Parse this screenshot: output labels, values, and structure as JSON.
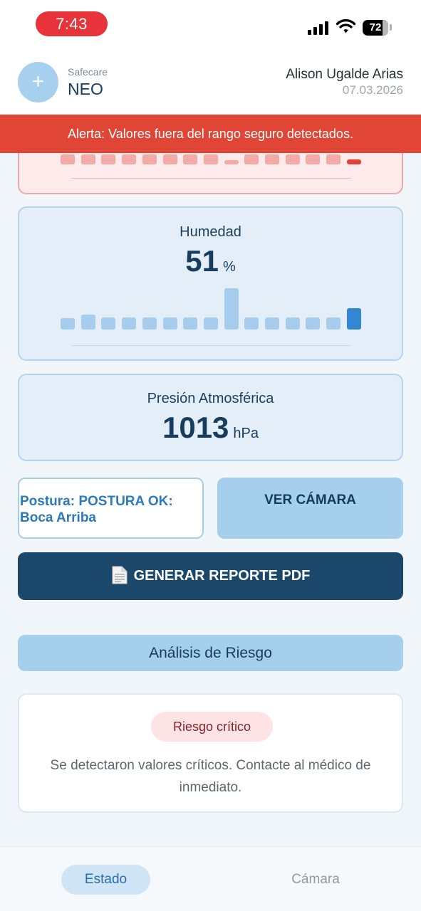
{
  "status_bar": {
    "time": "7:43",
    "battery": "72",
    "icons": [
      "signal-icon",
      "wifi-icon",
      "battery-icon"
    ]
  },
  "header": {
    "logo_symbol": "+",
    "brand_small": "Safecare",
    "brand_name": "NEO",
    "user_name": "Alison Ugalde Arias",
    "date": "07.03.2026"
  },
  "alert": {
    "text": "Alerta: Valores fuera del rango seguro detectados."
  },
  "temperature_card": {
    "bar_values": [
      10,
      10,
      10,
      10,
      10,
      10,
      10,
      10,
      4,
      10,
      10,
      10,
      10,
      10,
      5
    ],
    "highlight_index": 14,
    "colors": {
      "bar": "#f3a9a6",
      "highlight": "#e0423a",
      "background": "#fdeaea",
      "border": "#ecaaa8"
    }
  },
  "humidity_card": {
    "title": "Humedad",
    "value": "51",
    "unit": "%",
    "bar_values": [
      14,
      19,
      15,
      15,
      15,
      15,
      15,
      15,
      52,
      15,
      15,
      15,
      15,
      15,
      27
    ],
    "highlight_index": 14,
    "colors": {
      "bar": "#a6cdee",
      "highlight": "#3387d2",
      "background": "#e3eef9",
      "border": "#b4d3ee"
    }
  },
  "pressure_card": {
    "title": "Presión Atmosférica",
    "value": "1013",
    "unit": "hPa"
  },
  "posture": {
    "line1": "Postura: POSTURA OK:",
    "line2": "Boca Arriba"
  },
  "buttons": {
    "camera": "VER CÁMARA",
    "pdf": "GENERAR REPORTE PDF",
    "pdf_icon": "document-icon"
  },
  "risk": {
    "header": "Análisis de Riesgo",
    "badge": "Riesgo crítico",
    "message": "Se detectaron valores críticos. Contacte al médico de inmediato."
  },
  "bottom_nav": {
    "estado": "Estado",
    "camara": "Cámara",
    "active": "Estado"
  }
}
